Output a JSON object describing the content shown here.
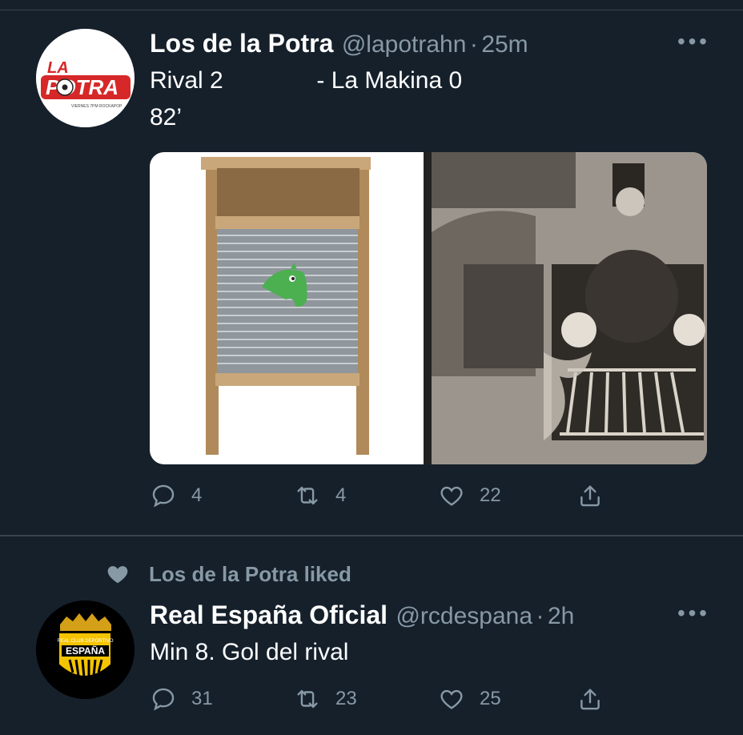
{
  "tweet1": {
    "name": "Los de la Potra",
    "handle": "@lapotrahn",
    "dot": "·",
    "time": "25m",
    "line1": "Rival 2              - La Makina 0",
    "line2": "82’",
    "logo_text": "LA POTRA",
    "logo_sub": "VIERNES 7PM ROCKAPOP",
    "replies": "4",
    "retweets": "4",
    "likes": "22"
  },
  "liked_label": "Los de la Potra liked",
  "tweet2": {
    "name": "Real España Oficial",
    "handle": "@rcdespana",
    "dot": "·",
    "time": "2h",
    "text": "Min 8. Gol del rival",
    "badge_top": "REAL CLUB DEPORTIVO",
    "badge_name": "ESPAÑA",
    "replies": "31",
    "retweets": "23",
    "likes": "25"
  },
  "colors": {
    "background": "#15202b",
    "secondary": "#8899a6",
    "separator": "#38444d"
  },
  "icons": [
    "more-icon",
    "reply-icon",
    "retweet-icon",
    "like-icon",
    "share-icon",
    "heart-icon",
    "crocodile-icon"
  ]
}
